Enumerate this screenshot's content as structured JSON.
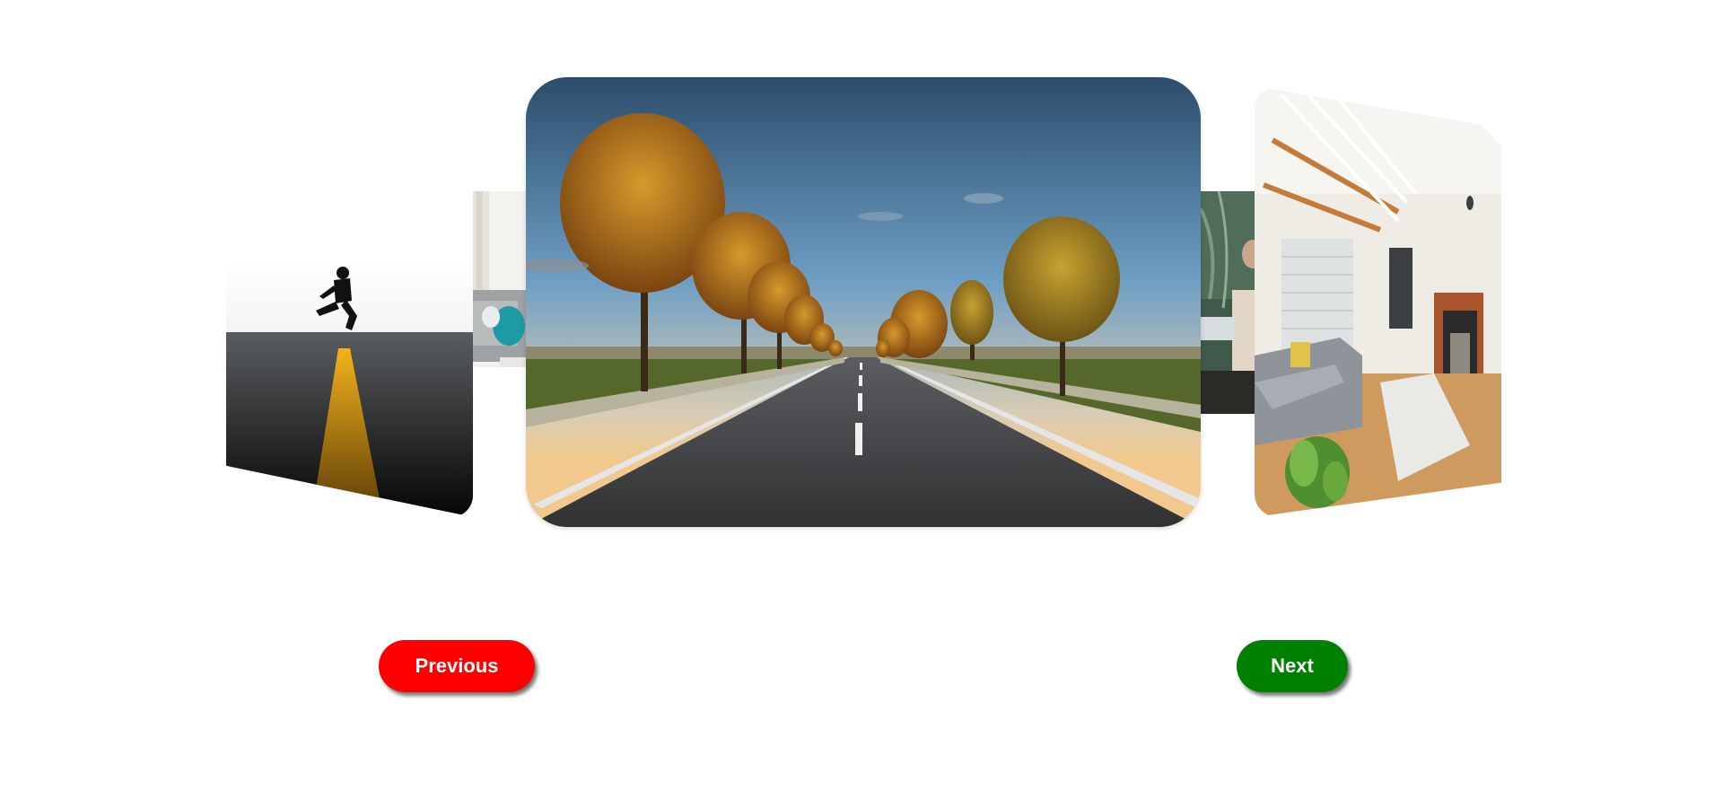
{
  "carousel": {
    "slides": [
      {
        "icon": "sofa-room-photo"
      },
      {
        "icon": "jumping-man-road-photo"
      },
      {
        "icon": "autumn-tree-road-photo"
      },
      {
        "icon": "person-laptop-photo"
      },
      {
        "icon": "living-room-photo"
      }
    ],
    "active_index": 2
  },
  "controls": {
    "previous_label": "Previous",
    "next_label": "Next",
    "previous_color": "#ff0000",
    "next_color": "#008000"
  }
}
